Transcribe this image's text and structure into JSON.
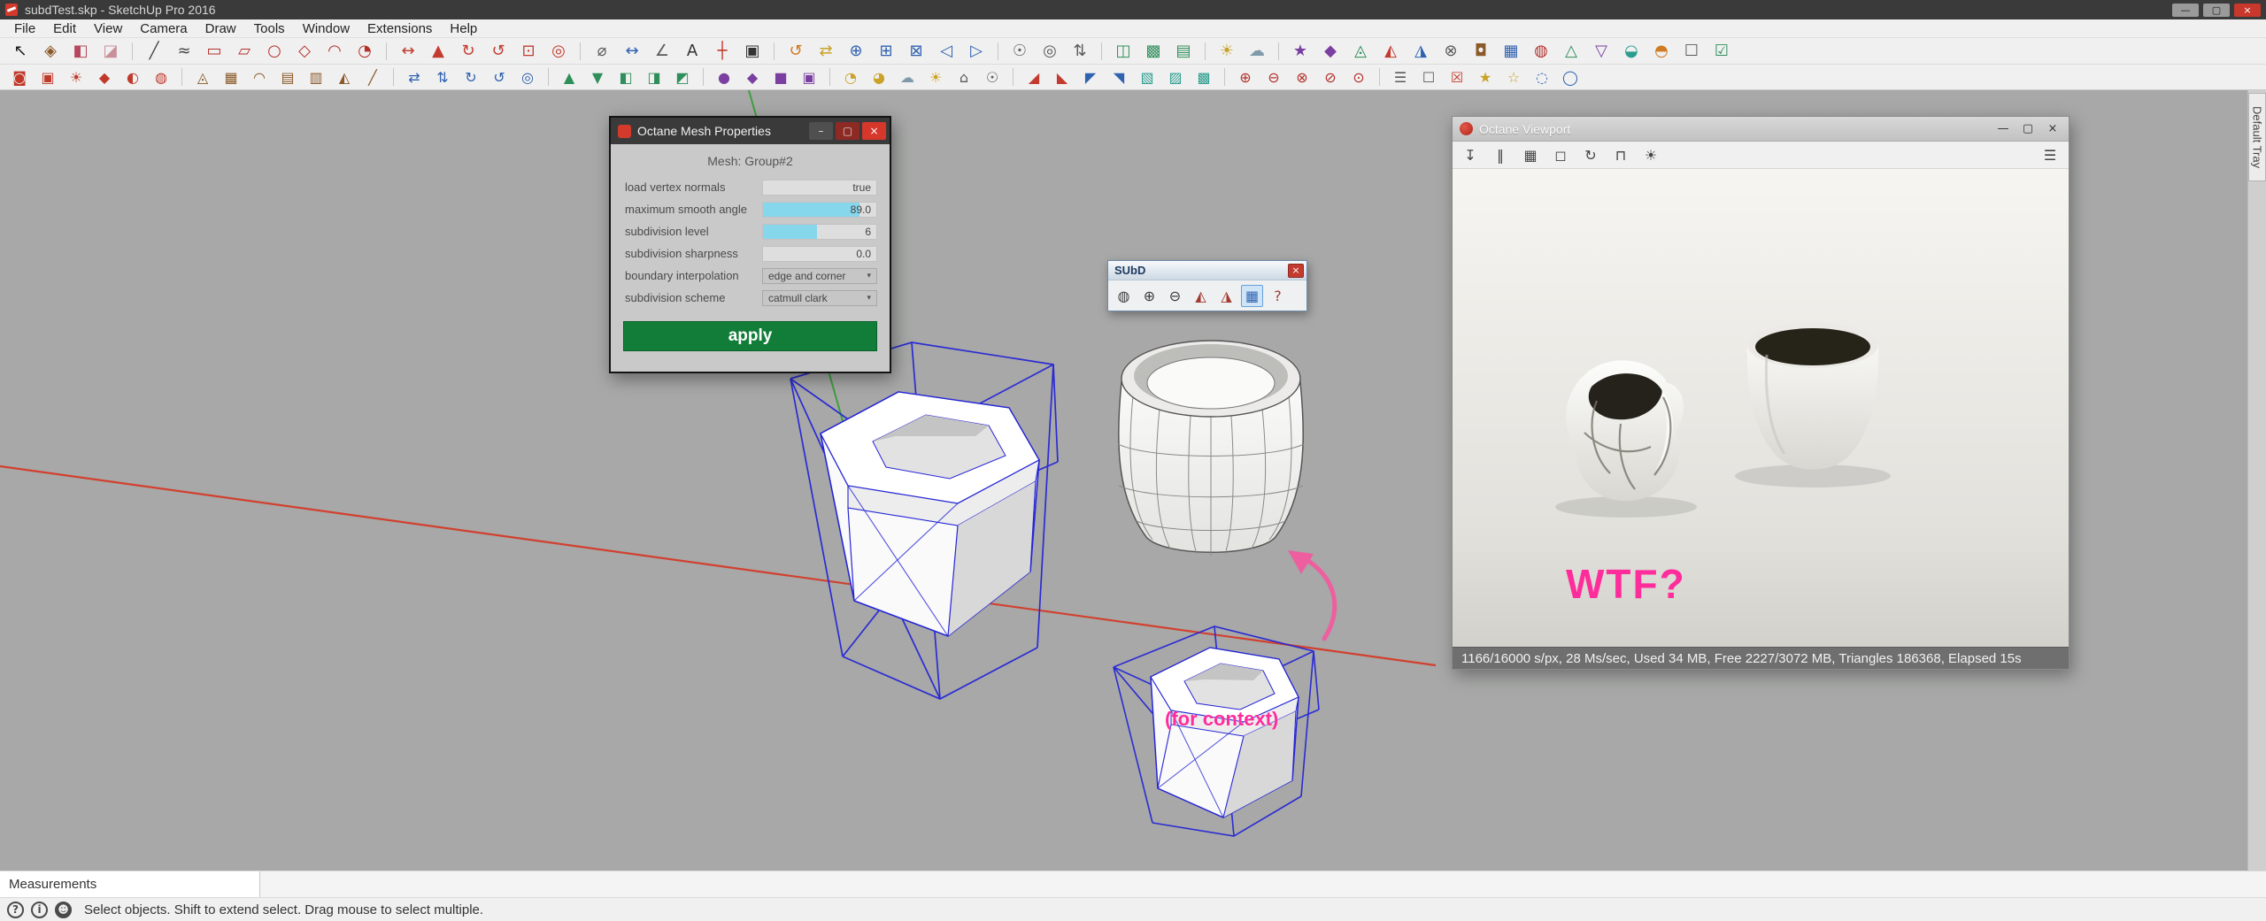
{
  "window": {
    "title": "subdTest.skp - SketchUp Pro 2016",
    "buttons": [
      {
        "name": "minimize-button",
        "glyph": "—",
        "bg": "#9a9a9a",
        "color": "#1a1a1a"
      },
      {
        "name": "maximize-button",
        "glyph": "▢",
        "bg": "#9a9a9a",
        "color": "#1a1a1a"
      },
      {
        "name": "close-button",
        "glyph": "×",
        "bg": "#c8382c",
        "color": "#ffffff"
      }
    ]
  },
  "menu": {
    "items": [
      {
        "name": "menu-file",
        "label": "File"
      },
      {
        "name": "menu-edit",
        "label": "Edit"
      },
      {
        "name": "menu-view",
        "label": "View"
      },
      {
        "name": "menu-camera",
        "label": "Camera"
      },
      {
        "name": "menu-draw",
        "label": "Draw"
      },
      {
        "name": "menu-tools",
        "label": "Tools"
      },
      {
        "name": "menu-window",
        "label": "Window"
      },
      {
        "name": "menu-extensions",
        "label": "Extensions"
      },
      {
        "name": "menu-help",
        "label": "Help"
      }
    ]
  },
  "toolbars": {
    "row1": [
      {
        "name": "select-tool-icon",
        "glyph": "↖",
        "color": "#1a1a1a"
      },
      {
        "name": "make-component-icon",
        "glyph": "◈",
        "color": "#8a5a2a"
      },
      {
        "name": "paint-bucket-icon",
        "glyph": "◧",
        "color": "#b5485e"
      },
      {
        "name": "eraser-icon",
        "glyph": "◪",
        "color": "#c98f9a"
      },
      {
        "sep": true
      },
      {
        "name": "line-tool-icon",
        "glyph": "╱",
        "color": "#444444"
      },
      {
        "name": "freehand-tool-icon",
        "glyph": "≈",
        "color": "#444444"
      },
      {
        "name": "rectangle-tool-icon",
        "glyph": "▭",
        "color": "#b3312a"
      },
      {
        "name": "rotated-rectangle-tool-icon",
        "glyph": "▱",
        "color": "#b3312a"
      },
      {
        "name": "circle-tool-icon",
        "glyph": "○",
        "color": "#b3312a"
      },
      {
        "name": "polygon-tool-icon",
        "glyph": "◇",
        "color": "#b3312a"
      },
      {
        "name": "arc-tool-icon",
        "glyph": "◠",
        "color": "#b3312a"
      },
      {
        "name": "pie-tool-icon",
        "glyph": "◔",
        "color": "#b3312a"
      },
      {
        "sep": true
      },
      {
        "name": "move-tool-icon",
        "glyph": "↔",
        "color": "#c23b2e"
      },
      {
        "name": "push-pull-tool-icon",
        "glyph": "▲",
        "color": "#c23b2e"
      },
      {
        "name": "rotate-tool-icon",
        "glyph": "↻",
        "color": "#c23b2e"
      },
      {
        "name": "follow-me-tool-icon",
        "glyph": "↺",
        "color": "#c23b2e"
      },
      {
        "name": "scale-tool-icon",
        "glyph": "⊡",
        "color": "#c23b2e"
      },
      {
        "name": "offset-tool-icon",
        "glyph": "◎",
        "color": "#c23b2e"
      },
      {
        "sep": true
      },
      {
        "name": "tape-measure-icon",
        "glyph": "⌀",
        "color": "#5a5a5a"
      },
      {
        "name": "dimension-tool-icon",
        "glyph": "↔",
        "color": "#2f62b0"
      },
      {
        "name": "protractor-icon",
        "glyph": "∠",
        "color": "#5a5a5a"
      },
      {
        "name": "text-tool-icon",
        "glyph": "A",
        "color": "#333333"
      },
      {
        "name": "axes-tool-icon",
        "glyph": "┼",
        "color": "#c23b2e"
      },
      {
        "name": "3d-text-icon",
        "glyph": "▣",
        "color": "#333333"
      },
      {
        "sep": true
      },
      {
        "name": "orbit-tool-icon",
        "glyph": "↺",
        "color": "#d07a22"
      },
      {
        "name": "pan-tool-icon",
        "glyph": "⇄",
        "color": "#c9a227"
      },
      {
        "name": "zoom-tool-icon",
        "glyph": "⊕",
        "color": "#2f62b0"
      },
      {
        "name": "zoom-window-icon",
        "glyph": "⊞",
        "color": "#2f62b0"
      },
      {
        "name": "zoom-extents-icon",
        "glyph": "⊠",
        "color": "#2f62b0"
      },
      {
        "name": "previous-view-icon",
        "glyph": "◁",
        "color": "#2f62b0"
      },
      {
        "name": "next-view-icon",
        "glyph": "▷",
        "color": "#2f62b0"
      },
      {
        "sep": true
      },
      {
        "name": "position-camera-icon",
        "glyph": "☉",
        "color": "#5a5a5a"
      },
      {
        "name": "look-around-icon",
        "glyph": "◎",
        "color": "#5a5a5a"
      },
      {
        "name": "walk-tool-icon",
        "glyph": "⇅",
        "color": "#5a5a5a"
      },
      {
        "sep": true
      },
      {
        "name": "section-plane-icon",
        "glyph": "◫",
        "color": "#2f8f5b"
      },
      {
        "name": "section-display-icon",
        "glyph": "▩",
        "color": "#2f8f5b"
      },
      {
        "name": "section-cuts-icon",
        "glyph": "▤",
        "color": "#2f8f5b"
      },
      {
        "sep": true
      },
      {
        "name": "shadows-icon",
        "glyph": "☀",
        "color": "#c9a227"
      },
      {
        "name": "fog-icon",
        "glyph": "☁",
        "color": "#7f9aa8"
      },
      {
        "sep": true
      },
      {
        "name": "plugin-icon-1",
        "glyph": "★",
        "color": "#7a3fa0"
      },
      {
        "name": "plugin-icon-2",
        "glyph": "◆",
        "color": "#7a3fa0"
      },
      {
        "name": "plugin-icon-3",
        "glyph": "◬",
        "color": "#2f8f5b"
      },
      {
        "name": "plugin-icon-4",
        "glyph": "◭",
        "color": "#c23b2e"
      },
      {
        "name": "plugin-icon-5",
        "glyph": "◮",
        "color": "#2f62b0"
      },
      {
        "name": "plugin-icon-6",
        "glyph": "⊗",
        "color": "#5a5a5a"
      },
      {
        "name": "plugin-icon-7",
        "glyph": "◘",
        "color": "#8a5a2a"
      },
      {
        "name": "plugin-icon-8",
        "glyph": "▦",
        "color": "#2f62b0"
      },
      {
        "name": "plugin-icon-9",
        "glyph": "◍",
        "color": "#b3312a"
      },
      {
        "name": "plugin-icon-10",
        "glyph": "△",
        "color": "#2f8f5b"
      },
      {
        "name": "plugin-icon-11",
        "glyph": "▽",
        "color": "#7a3fa0"
      },
      {
        "name": "plugin-icon-12",
        "glyph": "◒",
        "color": "#2a9d8f"
      },
      {
        "name": "plugin-icon-13",
        "glyph": "◓",
        "color": "#d07a22"
      },
      {
        "name": "plugin-icon-14",
        "glyph": "☐",
        "color": "#5a5a5a"
      },
      {
        "name": "plugin-icon-15",
        "glyph": "☑",
        "color": "#2f8f5b"
      }
    ],
    "row2": [
      {
        "name": "octane-render-icon",
        "glyph": "◙",
        "color": "#c0392b"
      },
      {
        "name": "octane-viewport-icon",
        "glyph": "▣",
        "color": "#c0392b"
      },
      {
        "name": "octane-settings-icon",
        "glyph": "☀",
        "color": "#c0392b"
      },
      {
        "name": "octane-material-icon",
        "glyph": "◆",
        "color": "#c0392b"
      },
      {
        "name": "octane-texture-icon",
        "glyph": "◐",
        "color": "#c0392b"
      },
      {
        "name": "octane-light-icon",
        "glyph": "◍",
        "color": "#c0392b"
      },
      {
        "sep": true
      },
      {
        "name": "sandbox-from-contours-icon",
        "glyph": "◬",
        "color": "#8a5a2a"
      },
      {
        "name": "sandbox-from-scratch-icon",
        "glyph": "▦",
        "color": "#8a5a2a"
      },
      {
        "name": "smoove-tool-icon",
        "glyph": "◠",
        "color": "#8a5a2a"
      },
      {
        "name": "stamp-tool-icon",
        "glyph": "▤",
        "color": "#8a5a2a"
      },
      {
        "name": "drape-tool-icon",
        "glyph": "▥",
        "color": "#8a5a2a"
      },
      {
        "name": "add-detail-icon",
        "glyph": "◭",
        "color": "#8a5a2a"
      },
      {
        "name": "flip-edge-icon",
        "glyph": "╱",
        "color": "#8a5a2a"
      },
      {
        "sep": true
      },
      {
        "name": "plugin2-icon-1",
        "glyph": "⇄",
        "color": "#2f62b0"
      },
      {
        "name": "plugin2-icon-2",
        "glyph": "⇅",
        "color": "#2f62b0"
      },
      {
        "name": "plugin2-icon-3",
        "glyph": "↻",
        "color": "#2f62b0"
      },
      {
        "name": "plugin2-icon-4",
        "glyph": "↺",
        "color": "#2f62b0"
      },
      {
        "name": "plugin2-icon-5",
        "glyph": "◎",
        "color": "#2f62b0"
      },
      {
        "sep": true
      },
      {
        "name": "plugin2-icon-6",
        "glyph": "▲",
        "color": "#2f8f5b"
      },
      {
        "name": "plugin2-icon-7",
        "glyph": "▼",
        "color": "#2f8f5b"
      },
      {
        "name": "plugin2-icon-8",
        "glyph": "◧",
        "color": "#2f8f5b"
      },
      {
        "name": "plugin2-icon-9",
        "glyph": "◨",
        "color": "#2f8f5b"
      },
      {
        "name": "plugin2-icon-10",
        "glyph": "◩",
        "color": "#2f8f5b"
      },
      {
        "sep": true
      },
      {
        "name": "plugin2-icon-11",
        "glyph": "●",
        "color": "#7a3fa0"
      },
      {
        "name": "plugin2-icon-12",
        "glyph": "◆",
        "color": "#7a3fa0"
      },
      {
        "name": "plugin2-icon-13",
        "glyph": "■",
        "color": "#7a3fa0"
      },
      {
        "name": "plugin2-icon-14",
        "glyph": "▣",
        "color": "#7a3fa0"
      },
      {
        "sep": true
      },
      {
        "name": "plugin2-icon-15",
        "glyph": "◔",
        "color": "#c9a227"
      },
      {
        "name": "plugin2-icon-16",
        "glyph": "◕",
        "color": "#c9a227"
      },
      {
        "name": "plugin2-icon-17",
        "glyph": "☁",
        "color": "#7f9aa8"
      },
      {
        "name": "plugin2-icon-18",
        "glyph": "☀",
        "color": "#c9a227"
      },
      {
        "name": "plugin2-icon-19",
        "glyph": "⌂",
        "color": "#5a5a5a"
      },
      {
        "name": "plugin2-icon-20",
        "glyph": "☉",
        "color": "#5a5a5a"
      },
      {
        "sep": true
      },
      {
        "name": "plugin2-icon-21",
        "glyph": "◢",
        "color": "#c23b2e"
      },
      {
        "name": "plugin2-icon-22",
        "glyph": "◣",
        "color": "#c23b2e"
      },
      {
        "name": "plugin2-icon-23",
        "glyph": "◤",
        "color": "#2f62b0"
      },
      {
        "name": "plugin2-icon-24",
        "glyph": "◥",
        "color": "#2f62b0"
      },
      {
        "name": "plugin2-icon-25",
        "glyph": "▧",
        "color": "#2a9d8f"
      },
      {
        "name": "plugin2-icon-26",
        "glyph": "▨",
        "color": "#2a9d8f"
      },
      {
        "name": "plugin2-icon-27",
        "glyph": "▩",
        "color": "#2a9d8f"
      },
      {
        "sep": true
      },
      {
        "name": "plugin2-icon-28",
        "glyph": "⊕",
        "color": "#b3312a"
      },
      {
        "name": "plugin2-icon-29",
        "glyph": "⊖",
        "color": "#b3312a"
      },
      {
        "name": "plugin2-icon-30",
        "glyph": "⊗",
        "color": "#b3312a"
      },
      {
        "name": "plugin2-icon-31",
        "glyph": "⊘",
        "color": "#b3312a"
      },
      {
        "name": "plugin2-icon-32",
        "glyph": "⊙",
        "color": "#b3312a"
      },
      {
        "sep": true
      },
      {
        "name": "plugin2-icon-33",
        "glyph": "☰",
        "color": "#5a5a5a"
      },
      {
        "name": "plugin2-icon-34",
        "glyph": "☐",
        "color": "#5a5a5a"
      },
      {
        "name": "plugin2-icon-35",
        "glyph": "☒",
        "color": "#c23b2e"
      },
      {
        "name": "plugin2-icon-36",
        "glyph": "★",
        "color": "#c9a227"
      },
      {
        "name": "plugin2-icon-37",
        "glyph": "☆",
        "color": "#c9a227"
      },
      {
        "name": "plugin2-icon-38",
        "glyph": "◌",
        "color": "#2f62b0"
      },
      {
        "name": "plugin2-icon-39",
        "glyph": "◯",
        "color": "#2f62b0"
      }
    ]
  },
  "canvas": {
    "annotations": {
      "for_context": "(for context)"
    }
  },
  "octane_mesh_properties": {
    "title": "Octane Mesh Properties",
    "mesh_label": "Mesh: Group#2",
    "buttons": [
      {
        "name": "minimize-button",
        "glyph": "–",
        "bg": "#4f4f4f",
        "color": "#dddddd"
      },
      {
        "name": "maximize-button",
        "glyph": "▢",
        "bg": "#8e2a24",
        "color": "#dddddd"
      },
      {
        "name": "close-button",
        "glyph": "×",
        "bg": "#d6372b",
        "color": "#ffffff"
      }
    ],
    "rows": [
      {
        "name": "row-load-vertex-normals",
        "label": "load vertex normals",
        "value": "true",
        "type": "field"
      },
      {
        "name": "row-maximum-smooth-angle",
        "label": "maximum smooth angle",
        "value": "89.0",
        "type": "slider",
        "fill": 85
      },
      {
        "name": "row-subdivision-level",
        "label": "subdivision level",
        "value": "6",
        "type": "slider",
        "fill": 48
      },
      {
        "name": "row-subdivision-sharpness",
        "label": "subdivision sharpness",
        "value": "0.0",
        "type": "field"
      },
      {
        "name": "row-boundary-interpolation",
        "label": "boundary interpolation",
        "value": "edge and corner",
        "type": "dropdown",
        "caret": "▾"
      },
      {
        "name": "row-subdivision-scheme",
        "label": "subdivision scheme",
        "value": "catmull clark",
        "type": "dropdown",
        "caret": "▾"
      }
    ],
    "apply_label": "apply"
  },
  "subd_toolbar": {
    "title": "SUbD",
    "close_glyph": "×",
    "icons": [
      {
        "name": "toggle-subdivision-icon",
        "glyph": "◍",
        "color": "#3a3a3a"
      },
      {
        "name": "increase-subdivision-icon",
        "glyph": "⊕",
        "color": "#3a3a3a"
      },
      {
        "name": "decrease-subdivision-icon",
        "glyph": "⊖",
        "color": "#3a3a3a"
      },
      {
        "name": "crease-tool-icon",
        "glyph": "◭",
        "color": "#a23b2e"
      },
      {
        "name": "analyze-mesh-icon",
        "glyph": "◮",
        "color": "#a23b2e"
      },
      {
        "name": "toggle-wireframe-icon",
        "glyph": "▦",
        "color": "#2f62b0",
        "selected": true
      },
      {
        "name": "subd-help-icon",
        "glyph": "?",
        "color": "#a23b2e"
      }
    ]
  },
  "octane_viewport": {
    "title": "Octane Viewport",
    "buttons": [
      {
        "name": "minimize-button",
        "glyph": "—",
        "color": "#333333"
      },
      {
        "name": "restore-button",
        "glyph": "▢",
        "color": "#333333"
      },
      {
        "name": "close-button",
        "glyph": "×",
        "color": "#333333"
      }
    ],
    "toolbar_icons": [
      {
        "name": "save-render-icon",
        "glyph": "↧",
        "color": "#444444"
      },
      {
        "name": "pause-render-icon",
        "glyph": "‖",
        "color": "#444444"
      },
      {
        "name": "subsampling-icon",
        "glyph": "▦",
        "color": "#444444"
      },
      {
        "name": "region-render-icon",
        "glyph": "◻",
        "color": "#444444"
      },
      {
        "name": "restart-render-icon",
        "glyph": "↻",
        "color": "#444444"
      },
      {
        "name": "lock-camera-icon",
        "glyph": "⊓",
        "color": "#444444"
      },
      {
        "name": "kernel-settings-icon",
        "glyph": "☀",
        "color": "#444444"
      }
    ],
    "menu_glyph": "☰",
    "annotation": "WTF?",
    "status": "1166/16000 s/px, 28 Ms/sec, Used 34 MB, Free 2227/3072 MB, Triangles 186368, Elapsed 15s"
  },
  "measurements": {
    "label": "Measurements"
  },
  "statusbar": {
    "icons": [
      {
        "name": "help-icon",
        "glyph": "?"
      },
      {
        "name": "info-icon",
        "glyph": "i"
      },
      {
        "name": "user-icon",
        "glyph": "☻",
        "bg": "#4a4a4a",
        "color": "#eeeeee"
      }
    ],
    "hint": "Select objects. Shift to extend select. Drag mouse to select multiple."
  },
  "default_tray": {
    "label": "Default Tray"
  },
  "colors": {
    "apply_green": "#117d38",
    "annotation_pink": "#ff2d9c",
    "wireframe_blue": "#2525d6",
    "axis_red": "#d2402f",
    "axis_green": "#3f9e3f",
    "octane_red": "#c0392b"
  }
}
